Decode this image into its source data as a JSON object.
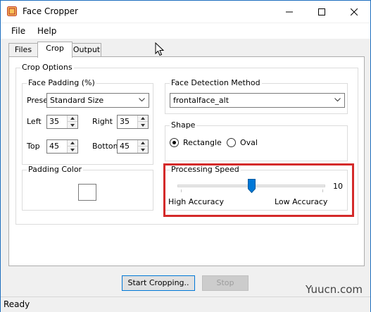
{
  "window": {
    "title": "Face Cropper"
  },
  "menu": {
    "items": [
      "File",
      "Help"
    ]
  },
  "tabs": [
    {
      "label": "Files",
      "active": false
    },
    {
      "label": "Crop",
      "active": true
    },
    {
      "label": "Output",
      "active": false
    }
  ],
  "crop_options": {
    "title": "Crop Options",
    "face_padding": {
      "title": "Face Padding (%)",
      "presets_label": "Presets",
      "preset_value": "Standard Size",
      "left_label": "Left",
      "left_value": "35",
      "right_label": "Right",
      "right_value": "35",
      "top_label": "Top",
      "top_value": "45",
      "bottom_label": "Bottom",
      "bottom_value": "45"
    },
    "face_detection": {
      "title": "Face Detection Method",
      "value": "frontalface_alt"
    },
    "shape": {
      "title": "Shape",
      "options": [
        "Rectangle",
        "Oval"
      ],
      "selected": "Rectangle"
    },
    "padding_color": {
      "title": "Padding Color",
      "color": "#ffffff"
    },
    "processing_speed": {
      "title": "Processing Speed",
      "value": "10",
      "level_fraction": 0.5,
      "min_label": "High Accuracy",
      "max_label": "Low Accuracy"
    }
  },
  "buttons": {
    "start": "Start Cropping..",
    "stop": "Stop"
  },
  "status": {
    "text": "Ready"
  },
  "watermark": "Yuucn.com",
  "colors": {
    "highlight": "#d42a2a",
    "accent": "#0078d7"
  }
}
